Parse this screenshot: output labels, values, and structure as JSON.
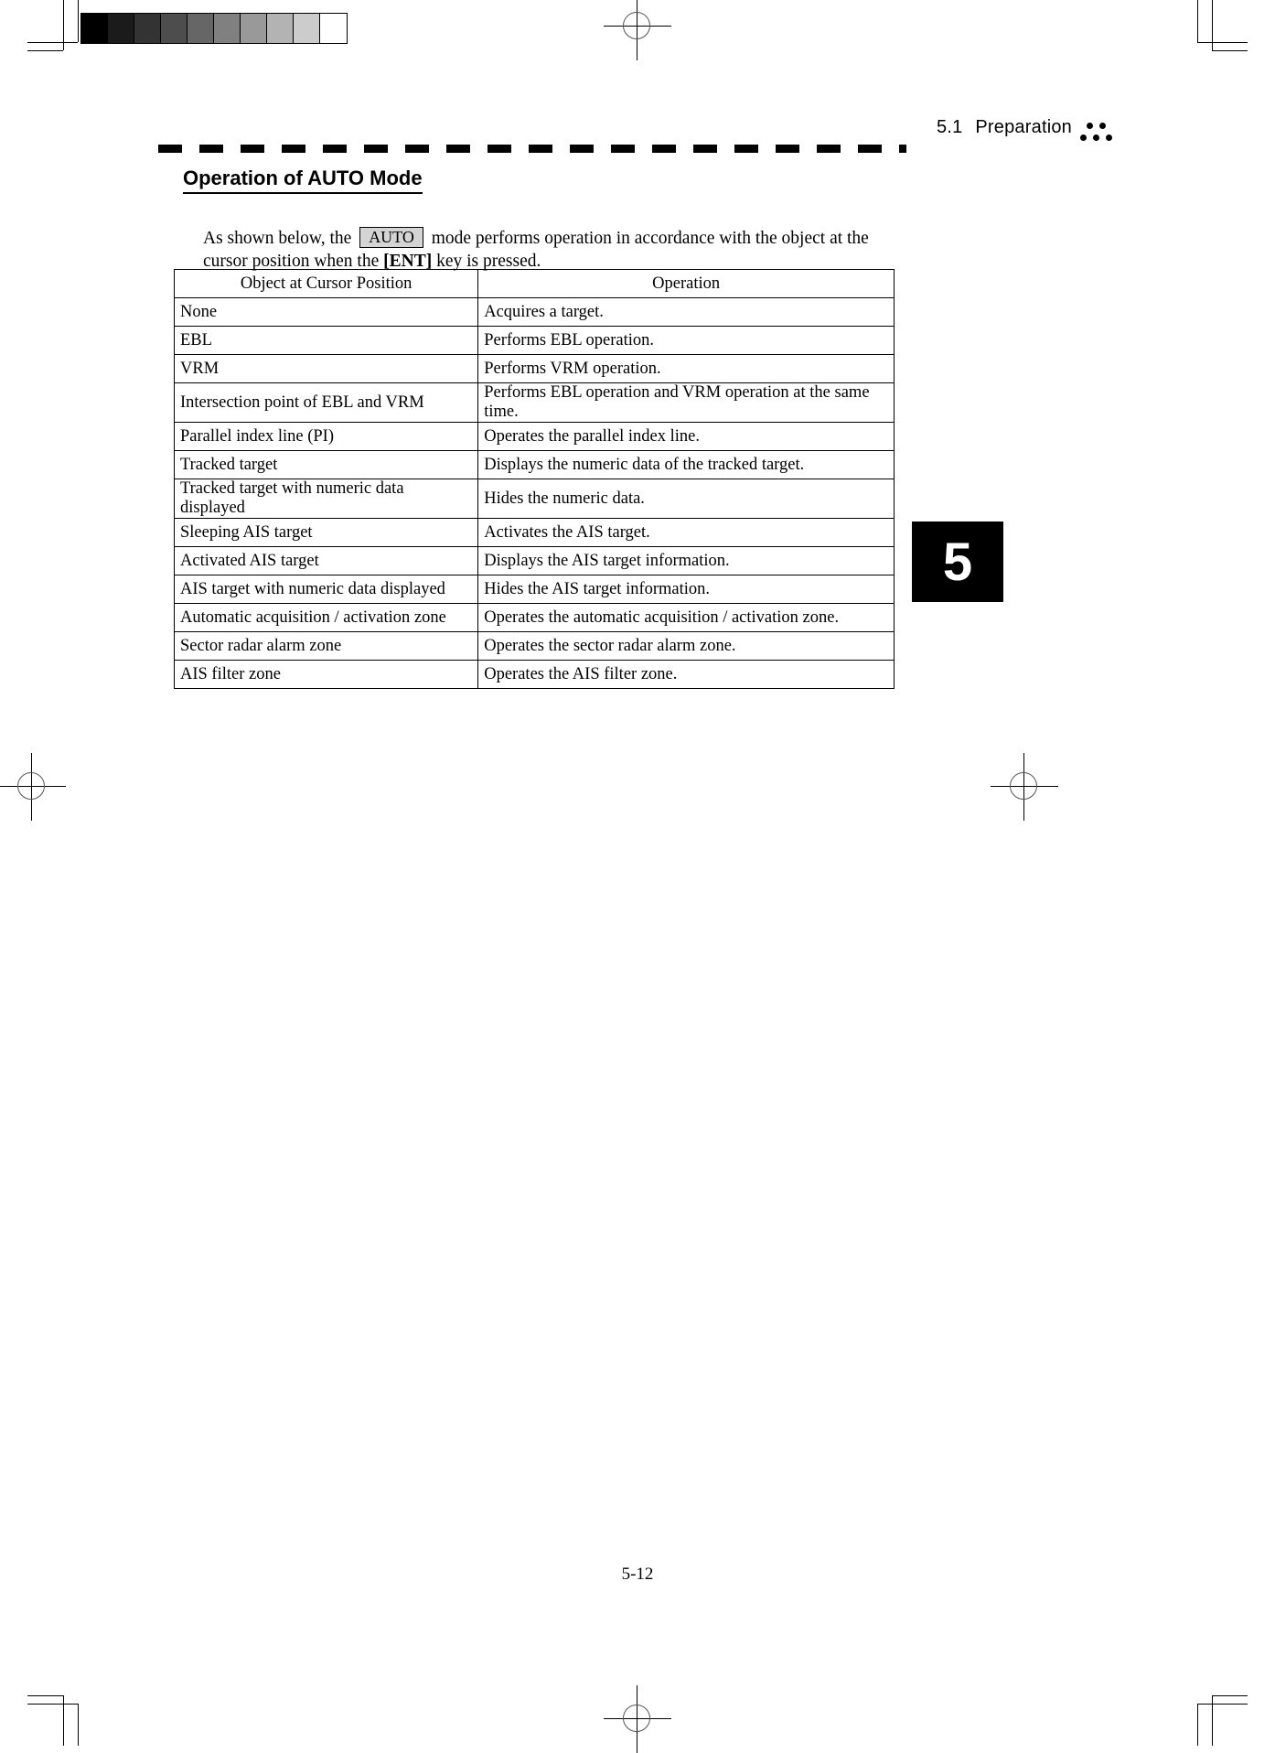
{
  "header": {
    "section_number": "5.1",
    "section_title": "Preparation",
    "dots_icon": "five-dots-icon"
  },
  "heading": "Operation of AUTO Mode",
  "intro": {
    "part1": "As shown below, the",
    "key_label": "AUTO",
    "part2": "mode performs operation in accordance with the object at the cursor position when the",
    "key2_label": "[ENT]",
    "part3": "key is pressed."
  },
  "table": {
    "columns": [
      "Object at Cursor Position",
      "Operation"
    ],
    "rows": [
      [
        "None",
        "Acquires a target."
      ],
      [
        "EBL",
        "Performs EBL operation."
      ],
      [
        "VRM",
        "Performs VRM operation."
      ],
      [
        "Intersection point of EBL and VRM",
        "Performs EBL operation and VRM operation at the same time."
      ],
      [
        "Parallel index line (PI)",
        "Operates the parallel index line."
      ],
      [
        "Tracked target",
        "Displays the numeric data of the tracked target."
      ],
      [
        "Tracked target with numeric data displayed",
        "Hides the numeric data."
      ],
      [
        "Sleeping AIS target",
        "Activates the AIS target."
      ],
      [
        "Activated AIS target",
        "Displays the AIS target information."
      ],
      [
        "AIS target with numeric data displayed",
        "Hides the AIS target information."
      ],
      [
        "Automatic acquisition / activation zone",
        "Operates the automatic acquisition / activation zone."
      ],
      [
        "Sector radar alarm zone",
        "Operates the sector radar alarm zone."
      ],
      [
        "AIS filter zone",
        "Operates the AIS filter zone."
      ]
    ]
  },
  "chapter_tab": "5",
  "footer": {
    "page_number": "5-12"
  },
  "calibration_strip": {
    "name": "grayscale-calibration-strip",
    "patches": [
      "#000000",
      "#1b1b1b",
      "#333333",
      "#4d4d4d",
      "#666666",
      "#808080",
      "#999999",
      "#b3b3b3",
      "#cccccc",
      "#ffffff"
    ]
  }
}
